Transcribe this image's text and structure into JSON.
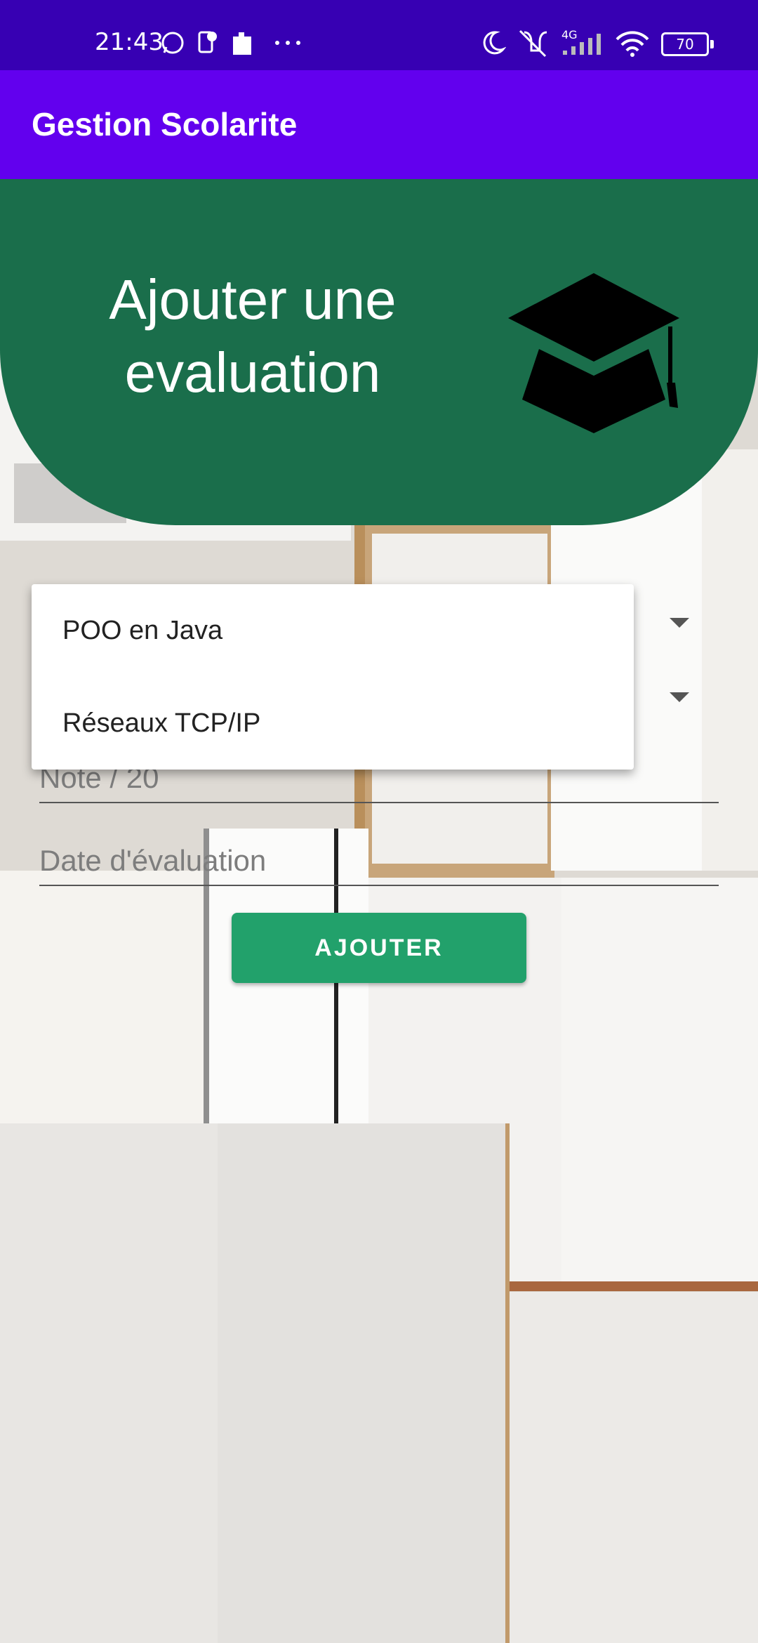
{
  "status_bar": {
    "time": "21:43",
    "battery": "70",
    "network": "4G",
    "icons": [
      "whatsapp-icon",
      "notification-icon",
      "puzzle-icon",
      "more-dots-icon",
      "moon-icon",
      "vibrate-off-icon",
      "signal-icon",
      "wifi-icon",
      "battery-icon"
    ]
  },
  "app_bar": {
    "title": "Gestion Scolarite"
  },
  "header": {
    "line1": "Ajouter une",
    "line2": "evaluation",
    "icon": "graduation-cap-icon",
    "color": "#1a6e4b"
  },
  "form": {
    "note_placeholder": "Note / 20",
    "date_placeholder": "Date d'évaluation",
    "submit_label": "AJOUTER"
  },
  "dropdown": {
    "options": [
      "POO en Java",
      "Réseaux TCP/IP"
    ]
  },
  "colors": {
    "status_bar": "#3700b3",
    "app_bar": "#6200ee",
    "button": "#22a16b"
  }
}
